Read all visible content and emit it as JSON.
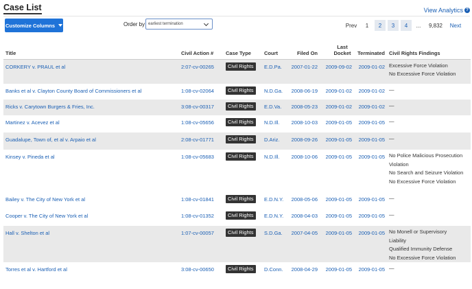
{
  "header": {
    "title": "Case List",
    "view_analytics": "View Analytics",
    "help_glyph": "?",
    "customize_label": "Customize Columns",
    "order_by_label": "Order by",
    "order_value": "earliest termination"
  },
  "pager": {
    "prev": "Prev",
    "pages": [
      "1",
      "2",
      "3",
      "4"
    ],
    "ellipsis": "...",
    "last": "9,832",
    "next": "Next"
  },
  "table": {
    "headers": [
      "Title",
      "Civil Action #",
      "Case Type",
      "Court",
      "Filed On",
      "Last Docket",
      "Terminated",
      "Civil Rights Findings"
    ],
    "rows": [
      {
        "title": "CORKERY v. PRAUL et al",
        "action": "2:07-cv-00265",
        "type": "Civil Rights",
        "court": "E.D.Pa.",
        "filed": "2007-01-22",
        "last": "2009-09-02",
        "term": "2009-01-02",
        "findings": [
          "Excessive Force Violation",
          "No Excessive Force Violation"
        ]
      },
      {
        "title": "Banks et al v. Clayton County Board of Commissioners et al",
        "action": "1:08-cv-02064",
        "type": "Civil Rights",
        "court": "N.D.Ga.",
        "filed": "2008-06-19",
        "last": "2009-01-02",
        "term": "2009-01-02",
        "findings": [
          "—"
        ]
      },
      {
        "title": "Ricks v. Carytown Burgers & Fries, Inc.",
        "action": "3:08-cv-00317",
        "type": "Civil Rights",
        "court": "E.D.Va.",
        "filed": "2008-05-23",
        "last": "2009-01-02",
        "term": "2009-01-02",
        "findings": [
          "—"
        ]
      },
      {
        "title": "Martinez v. Acevez et al",
        "action": "1:08-cv-05656",
        "type": "Civil Rights",
        "court": "N.D.Ill.",
        "filed": "2008-10-03",
        "last": "2009-01-05",
        "term": "2009-01-05",
        "findings": [
          "—"
        ]
      },
      {
        "title": "Guadalupe, Town of, et al v. Arpaio et al",
        "action": "2:08-cv-01771",
        "type": "Civil Rights",
        "court": "D.Ariz.",
        "filed": "2008-09-26",
        "last": "2009-01-05",
        "term": "2009-01-05",
        "findings": [
          "—"
        ]
      },
      {
        "title": "Kinsey v. Pineda et al",
        "action": "1:08-cv-05683",
        "type": "Civil Rights",
        "court": "N.D.Ill.",
        "filed": "2008-10-06",
        "last": "2009-01-05",
        "term": "2009-01-05",
        "findings": [
          "No Police Malicious Prosecution",
          "Violation",
          "No Search and Seizure Violation",
          "No Excessive Force Violation"
        ]
      },
      {
        "title": "Bailey v. The City of New York et al",
        "action": "1:08-cv-01841",
        "type": "Civil Rights",
        "court": "E.D.N.Y.",
        "filed": "2008-05-06",
        "last": "2009-01-05",
        "term": "2009-01-05",
        "findings": [
          "—"
        ]
      },
      {
        "title": "Cooper v. The City of New York et al",
        "action": "1:08-cv-01352",
        "type": "Civil Rights",
        "court": "E.D.N.Y.",
        "filed": "2008-04-03",
        "last": "2009-01-05",
        "term": "2009-01-05",
        "findings": [
          "—"
        ]
      },
      {
        "title": "Hall v. Shelton et al",
        "action": "1:07-cv-00057",
        "type": "Civil Rights",
        "court": "S.D.Ga.",
        "filed": "2007-04-05",
        "last": "2009-01-05",
        "term": "2009-01-05",
        "findings": [
          "No Monell or Supervisory",
          "Liability",
          "Qualified Immunity Defense",
          "No Excessive Force Violation"
        ]
      },
      {
        "title": "Torres et al v. Hartford et al",
        "action": "3:08-cv-00650",
        "type": "Civil Rights",
        "court": "D.Conn.",
        "filed": "2008-04-29",
        "last": "2009-01-05",
        "term": "2009-01-05",
        "findings": [
          "—"
        ]
      }
    ]
  }
}
